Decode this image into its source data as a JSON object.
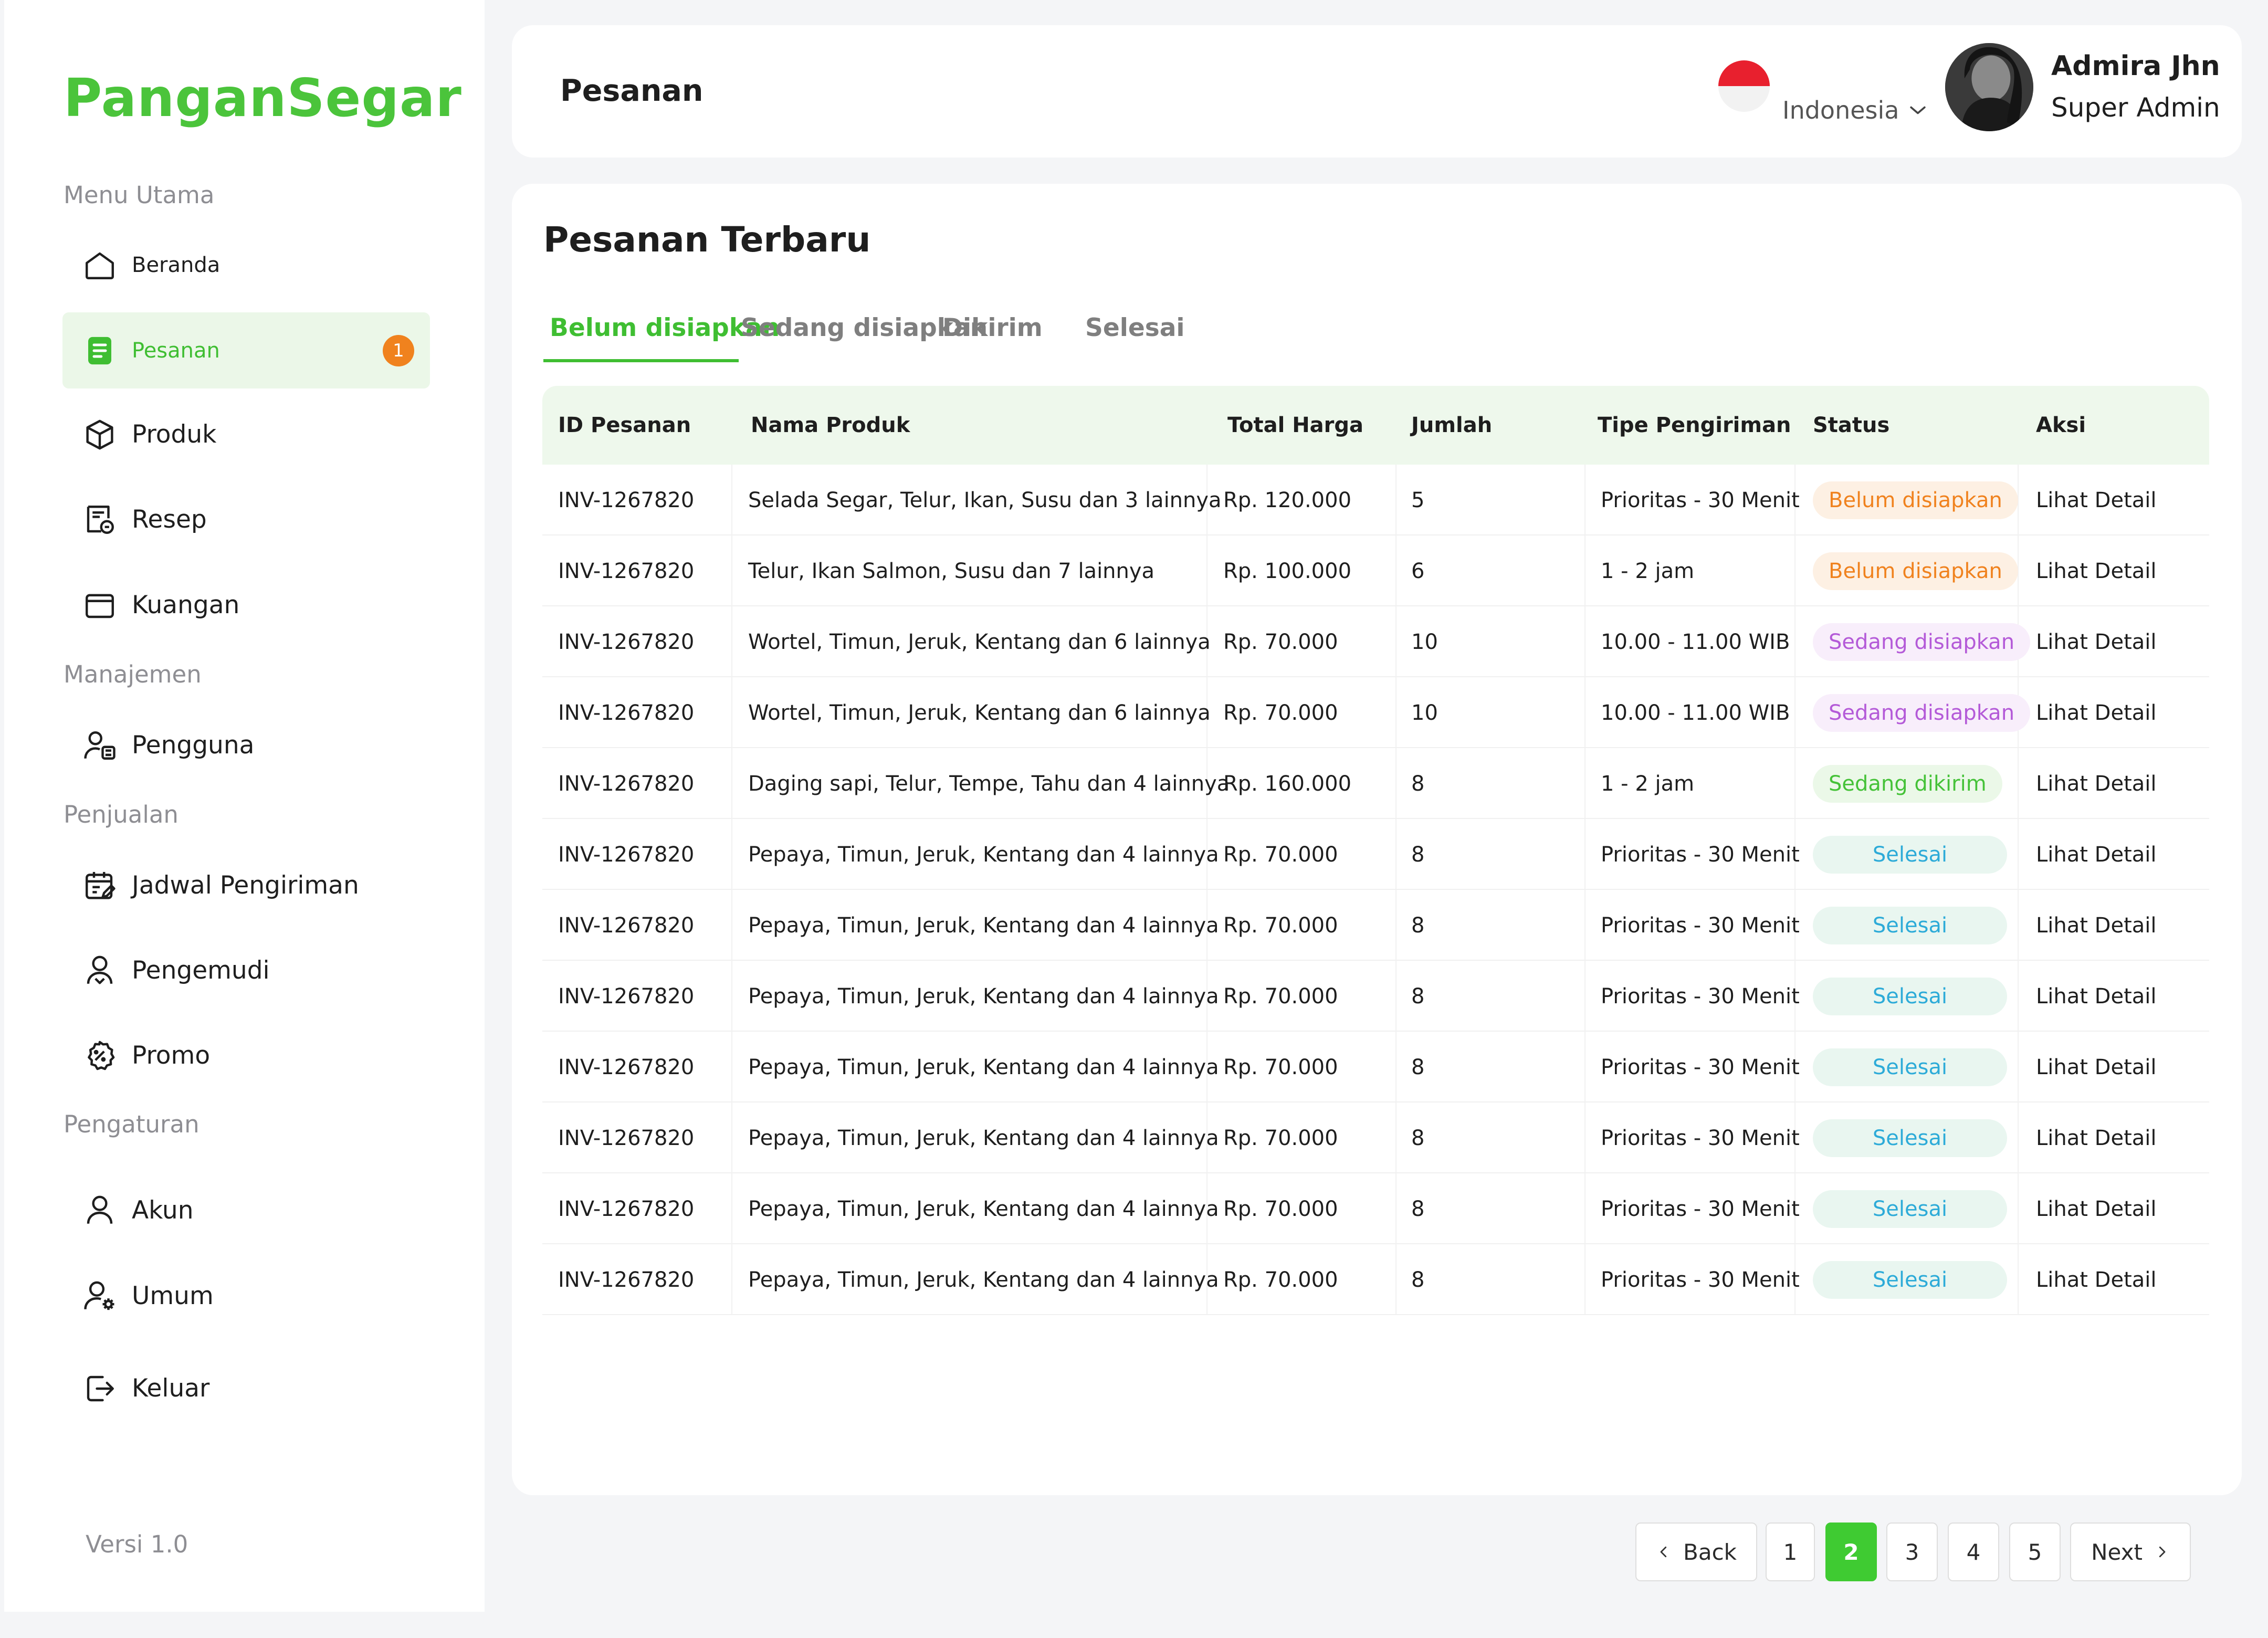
{
  "brand": {
    "name": "PanganSegar",
    "version": "Versi 1.0"
  },
  "sidebar": {
    "sections": [
      "Menu Utama",
      "Manajemen",
      "Penjualan",
      "Pengaturan"
    ],
    "items": [
      {
        "label": "Beranda",
        "icon": "home-icon"
      },
      {
        "label": "Pesanan",
        "icon": "order-icon",
        "badge": "1",
        "active": true
      },
      {
        "label": "Produk",
        "icon": "box-icon"
      },
      {
        "label": "Resep",
        "icon": "recipe-icon"
      },
      {
        "label": "Kuangan",
        "icon": "wallet-icon"
      },
      {
        "label": "Pengguna",
        "icon": "user-list-icon"
      },
      {
        "label": "Jadwal Pengiriman",
        "icon": "calendar-edit-icon"
      },
      {
        "label": "Pengemudi",
        "icon": "driver-icon"
      },
      {
        "label": "Promo",
        "icon": "promo-icon"
      },
      {
        "label": "Akun",
        "icon": "user-icon"
      },
      {
        "label": "Umum",
        "icon": "user-settings-icon"
      },
      {
        "label": "Keluar",
        "icon": "logout-icon"
      }
    ]
  },
  "header": {
    "title": "Pesanan",
    "language": "Indonesia",
    "user": {
      "name": "Admira Jhn",
      "role": "Super Admin"
    }
  },
  "main": {
    "title": "Pesanan Terbaru",
    "tabs": [
      "Belum disiapkan",
      "Sedang disiapkan",
      "Dikirim",
      "Selesai"
    ],
    "active_tab": "Belum disiapkan",
    "table": {
      "columns": [
        "ID Pesanan",
        "Nama Produk",
        "Total Harga",
        "Jumlah",
        "Tipe Pengiriman",
        "Status",
        "Aksi"
      ],
      "rows": [
        {
          "id": "INV-1267820",
          "product": "Selada Segar, Telur, Ikan, Susu dan 3 lainnya",
          "total": "Rp. 120.000",
          "qty": "5",
          "shipping": "Prioritas - 30 Menit",
          "status": "Belum disiapkan",
          "action": "Lihat Detail"
        },
        {
          "id": "INV-1267820",
          "product": "Telur, Ikan Salmon, Susu dan 7 lainnya",
          "total": "Rp. 100.000",
          "qty": "6",
          "shipping": "1 - 2 jam",
          "status": "Belum disiapkan",
          "action": "Lihat Detail"
        },
        {
          "id": "INV-1267820",
          "product": "Wortel, Timun, Jeruk, Kentang dan 6 lainnya",
          "total": "Rp. 70.000",
          "qty": "10",
          "shipping": "10.00 - 11.00 WIB",
          "status": "Sedang disiapkan",
          "action": "Lihat Detail"
        },
        {
          "id": "INV-1267820",
          "product": "Wortel, Timun, Jeruk, Kentang dan 6 lainnya",
          "total": "Rp. 70.000",
          "qty": "10",
          "shipping": "10.00 - 11.00 WIB",
          "status": "Sedang disiapkan",
          "action": "Lihat Detail"
        },
        {
          "id": "INV-1267820",
          "product": "Daging sapi, Telur, Tempe, Tahu dan 4 lainnya",
          "total": "Rp. 160.000",
          "qty": "8",
          "shipping": "1 - 2 jam",
          "status": "Sedang dikirim",
          "action": "Lihat Detail"
        },
        {
          "id": "INV-1267820",
          "product": "Pepaya, Timun, Jeruk, Kentang dan 4 lainnya",
          "total": "Rp. 70.000",
          "qty": "8",
          "shipping": "Prioritas - 30 Menit",
          "status": "Selesai",
          "action": "Lihat Detail"
        },
        {
          "id": "INV-1267820",
          "product": "Pepaya, Timun, Jeruk, Kentang dan 4 lainnya",
          "total": "Rp. 70.000",
          "qty": "8",
          "shipping": "Prioritas - 30 Menit",
          "status": "Selesai",
          "action": "Lihat Detail"
        },
        {
          "id": "INV-1267820",
          "product": "Pepaya, Timun, Jeruk, Kentang dan 4 lainnya",
          "total": "Rp. 70.000",
          "qty": "8",
          "shipping": "Prioritas - 30 Menit",
          "status": "Selesai",
          "action": "Lihat Detail"
        },
        {
          "id": "INV-1267820",
          "product": "Pepaya, Timun, Jeruk, Kentang dan 4 lainnya",
          "total": "Rp. 70.000",
          "qty": "8",
          "shipping": "Prioritas - 30 Menit",
          "status": "Selesai",
          "action": "Lihat Detail"
        },
        {
          "id": "INV-1267820",
          "product": "Pepaya, Timun, Jeruk, Kentang dan 4 lainnya",
          "total": "Rp. 70.000",
          "qty": "8",
          "shipping": "Prioritas - 30 Menit",
          "status": "Selesai",
          "action": "Lihat Detail"
        },
        {
          "id": "INV-1267820",
          "product": "Pepaya, Timun, Jeruk, Kentang dan 4 lainnya",
          "total": "Rp. 70.000",
          "qty": "8",
          "shipping": "Prioritas - 30 Menit",
          "status": "Selesai",
          "action": "Lihat Detail"
        },
        {
          "id": "INV-1267820",
          "product": "Pepaya, Timun, Jeruk, Kentang dan 4 lainnya",
          "total": "Rp. 70.000",
          "qty": "8",
          "shipping": "Prioritas - 30 Menit",
          "status": "Selesai",
          "action": "Lihat Detail"
        }
      ]
    },
    "pagination": {
      "back": "Back",
      "next": "Next",
      "pages": [
        "1",
        "2",
        "3",
        "4",
        "5"
      ],
      "current": "2"
    }
  },
  "colors": {
    "accent": "#3fbe32",
    "badge": "#f0821e",
    "page_bg": "#f4f5f7"
  }
}
